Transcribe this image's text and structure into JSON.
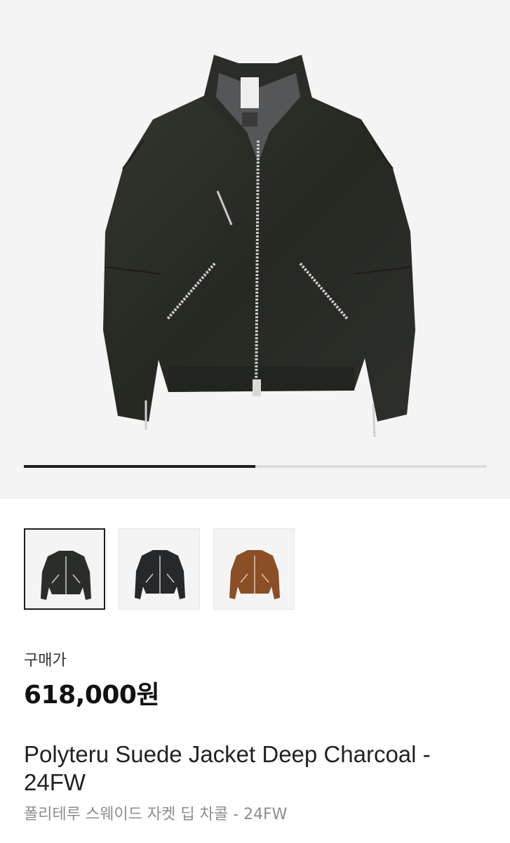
{
  "gallery": {
    "image_alt": "Polyteru Suede Jacket Deep Charcoal",
    "current_index": 1,
    "total_images": 2,
    "progress_fraction": 0.5,
    "thumbnails": [
      {
        "label": "deep-charcoal-front",
        "color": "#2b2d29",
        "selected": true
      },
      {
        "label": "deep-charcoal-alt",
        "color": "#26292b",
        "selected": false
      },
      {
        "label": "brown-suede",
        "color": "#8a4f26",
        "selected": false
      }
    ]
  },
  "price": {
    "label": "구매가",
    "value": "618,000원"
  },
  "product": {
    "title": "Polyteru Suede Jacket Deep Charcoal - 24FW",
    "subtitle": "폴리테루 스웨이드 자켓 딥 차콜 - 24FW"
  }
}
